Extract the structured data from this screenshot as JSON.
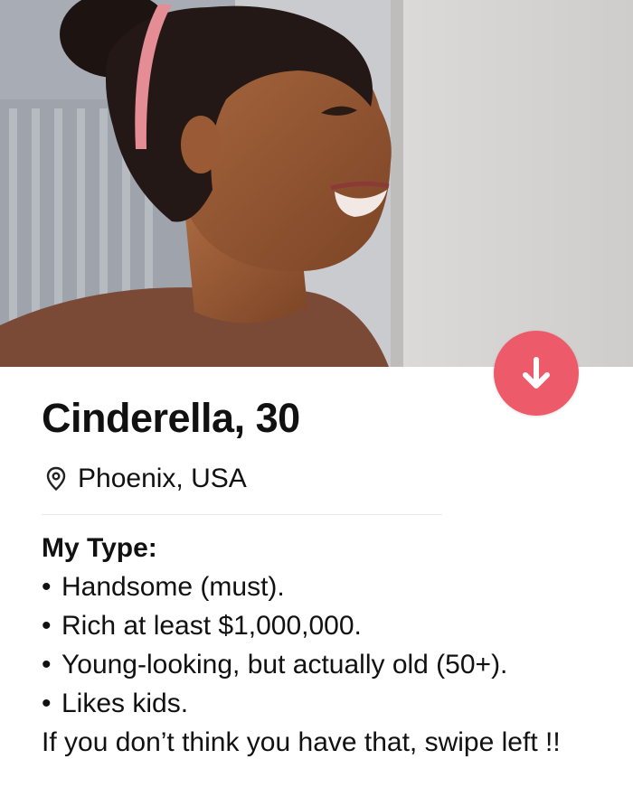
{
  "profile": {
    "name_age": "Cinderella, 30",
    "location": "Phoenix, USA",
    "location_icon": "map-pin-icon",
    "action_icon": "arrow-down-icon",
    "accent_color": "#ed5b6a"
  },
  "bio": {
    "heading": "My Type:",
    "bullet_symbol": "•",
    "items": [
      "Handsome (must).",
      "Rich at least $1,000,000.",
      "Young-looking, but actually old (50+).",
      "Likes kids."
    ],
    "closing": "If you don’t think you have that, swipe left !!"
  }
}
